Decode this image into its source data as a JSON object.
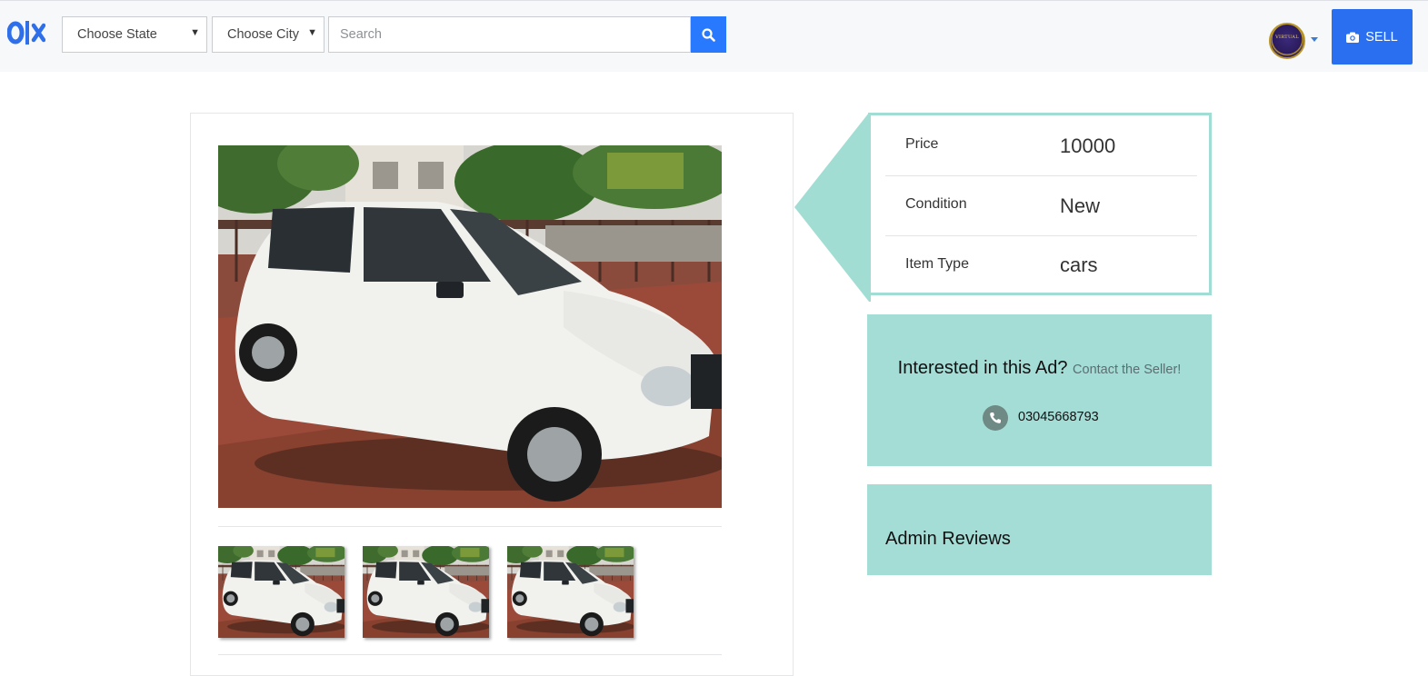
{
  "app": {
    "logo_text": "olx",
    "brand_color": "#2979ff"
  },
  "navbar": {
    "state_select": {
      "value": "Choose State"
    },
    "city_select": {
      "value": "Choose City"
    },
    "search": {
      "placeholder": "Search",
      "value": ""
    },
    "search_icon": "search-icon",
    "avatar_text": "VIRTUAL",
    "sell_label": "SELL",
    "sell_icon": "camera-icon"
  },
  "listing": {
    "photo_subject": "white hatchback car",
    "thumbnail_count": 3,
    "details": [
      {
        "key": "Price",
        "value": "10000"
      },
      {
        "key": "Condition",
        "value": "New"
      },
      {
        "key": "Item Type",
        "value": "cars"
      }
    ]
  },
  "contact": {
    "heading": "Interested in this Ad?",
    "link": "Contact the Seller!",
    "phone_icon": "phone-icon",
    "phone": "03045668793"
  },
  "reviews": {
    "title": "Admin Reviews"
  },
  "colors": {
    "accent": "#2a6ff0",
    "panel": "#a3ddd5",
    "panel_border": "#a2ddd4"
  }
}
